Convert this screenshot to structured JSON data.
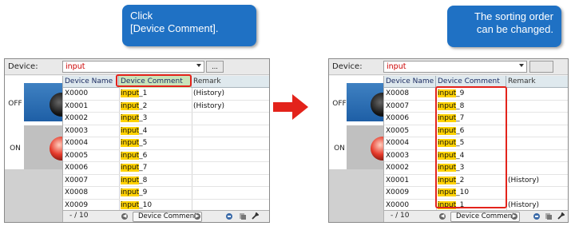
{
  "colors": {
    "callout": "#1f71c4",
    "highlight": "#ffd200",
    "red": "#e3231b",
    "header": "#dfe9ee"
  },
  "callout_left": {
    "line1": "Click",
    "line2": "[Device Comment]."
  },
  "callout_right": {
    "line1": "The sorting order",
    "line2": "can be changed."
  },
  "left_panel": {
    "device_label": "Device:",
    "device_value": "input",
    "ellipsis": "...",
    "side": {
      "off": "OFF",
      "on": "ON"
    },
    "columns": {
      "name": "Device Name",
      "comment": "Device Comment",
      "remark": "Remark"
    },
    "rows": [
      {
        "name": "X0000",
        "prefix": "input",
        "suffix": "_1",
        "remark": "(History)"
      },
      {
        "name": "X0001",
        "prefix": "input",
        "suffix": "_2",
        "remark": "(History)"
      },
      {
        "name": "X0002",
        "prefix": "input",
        "suffix": "_3",
        "remark": ""
      },
      {
        "name": "X0003",
        "prefix": "input",
        "suffix": "_4",
        "remark": ""
      },
      {
        "name": "X0004",
        "prefix": "input",
        "suffix": "_5",
        "remark": ""
      },
      {
        "name": "X0005",
        "prefix": "input",
        "suffix": "_6",
        "remark": ""
      },
      {
        "name": "X0006",
        "prefix": "input",
        "suffix": "_7",
        "remark": ""
      },
      {
        "name": "X0007",
        "prefix": "input",
        "suffix": "_8",
        "remark": ""
      },
      {
        "name": "X0008",
        "prefix": "input",
        "suffix": "_9",
        "remark": ""
      },
      {
        "name": "X0009",
        "prefix": "input",
        "suffix": "_10",
        "remark": ""
      }
    ],
    "footer": {
      "page": "- / 10",
      "sort_button": "Device Comment"
    }
  },
  "right_panel": {
    "device_label": "Device:",
    "device_value": "input",
    "side": {
      "off": "OFF",
      "on": "ON"
    },
    "columns": {
      "name": "Device Name",
      "comment": "Device Comment",
      "remark": "Remark"
    },
    "rows": [
      {
        "name": "X0008",
        "prefix": "input",
        "suffix": "_9",
        "remark": ""
      },
      {
        "name": "X0007",
        "prefix": "input",
        "suffix": "_8",
        "remark": ""
      },
      {
        "name": "X0006",
        "prefix": "input",
        "suffix": "_7",
        "remark": ""
      },
      {
        "name": "X0005",
        "prefix": "input",
        "suffix": "_6",
        "remark": ""
      },
      {
        "name": "X0004",
        "prefix": "input",
        "suffix": "_5",
        "remark": ""
      },
      {
        "name": "X0003",
        "prefix": "input",
        "suffix": "_4",
        "remark": ""
      },
      {
        "name": "X0002",
        "prefix": "input",
        "suffix": "_3",
        "remark": ""
      },
      {
        "name": "X0001",
        "prefix": "input",
        "suffix": "_2",
        "remark": "(History)"
      },
      {
        "name": "X0009",
        "prefix": "input",
        "suffix": "_10",
        "remark": ""
      },
      {
        "name": "X0000",
        "prefix": "input",
        "suffix": "_1",
        "remark": "(History)"
      }
    ],
    "footer": {
      "page": "- / 10",
      "sort_button": "Device Comment"
    }
  }
}
